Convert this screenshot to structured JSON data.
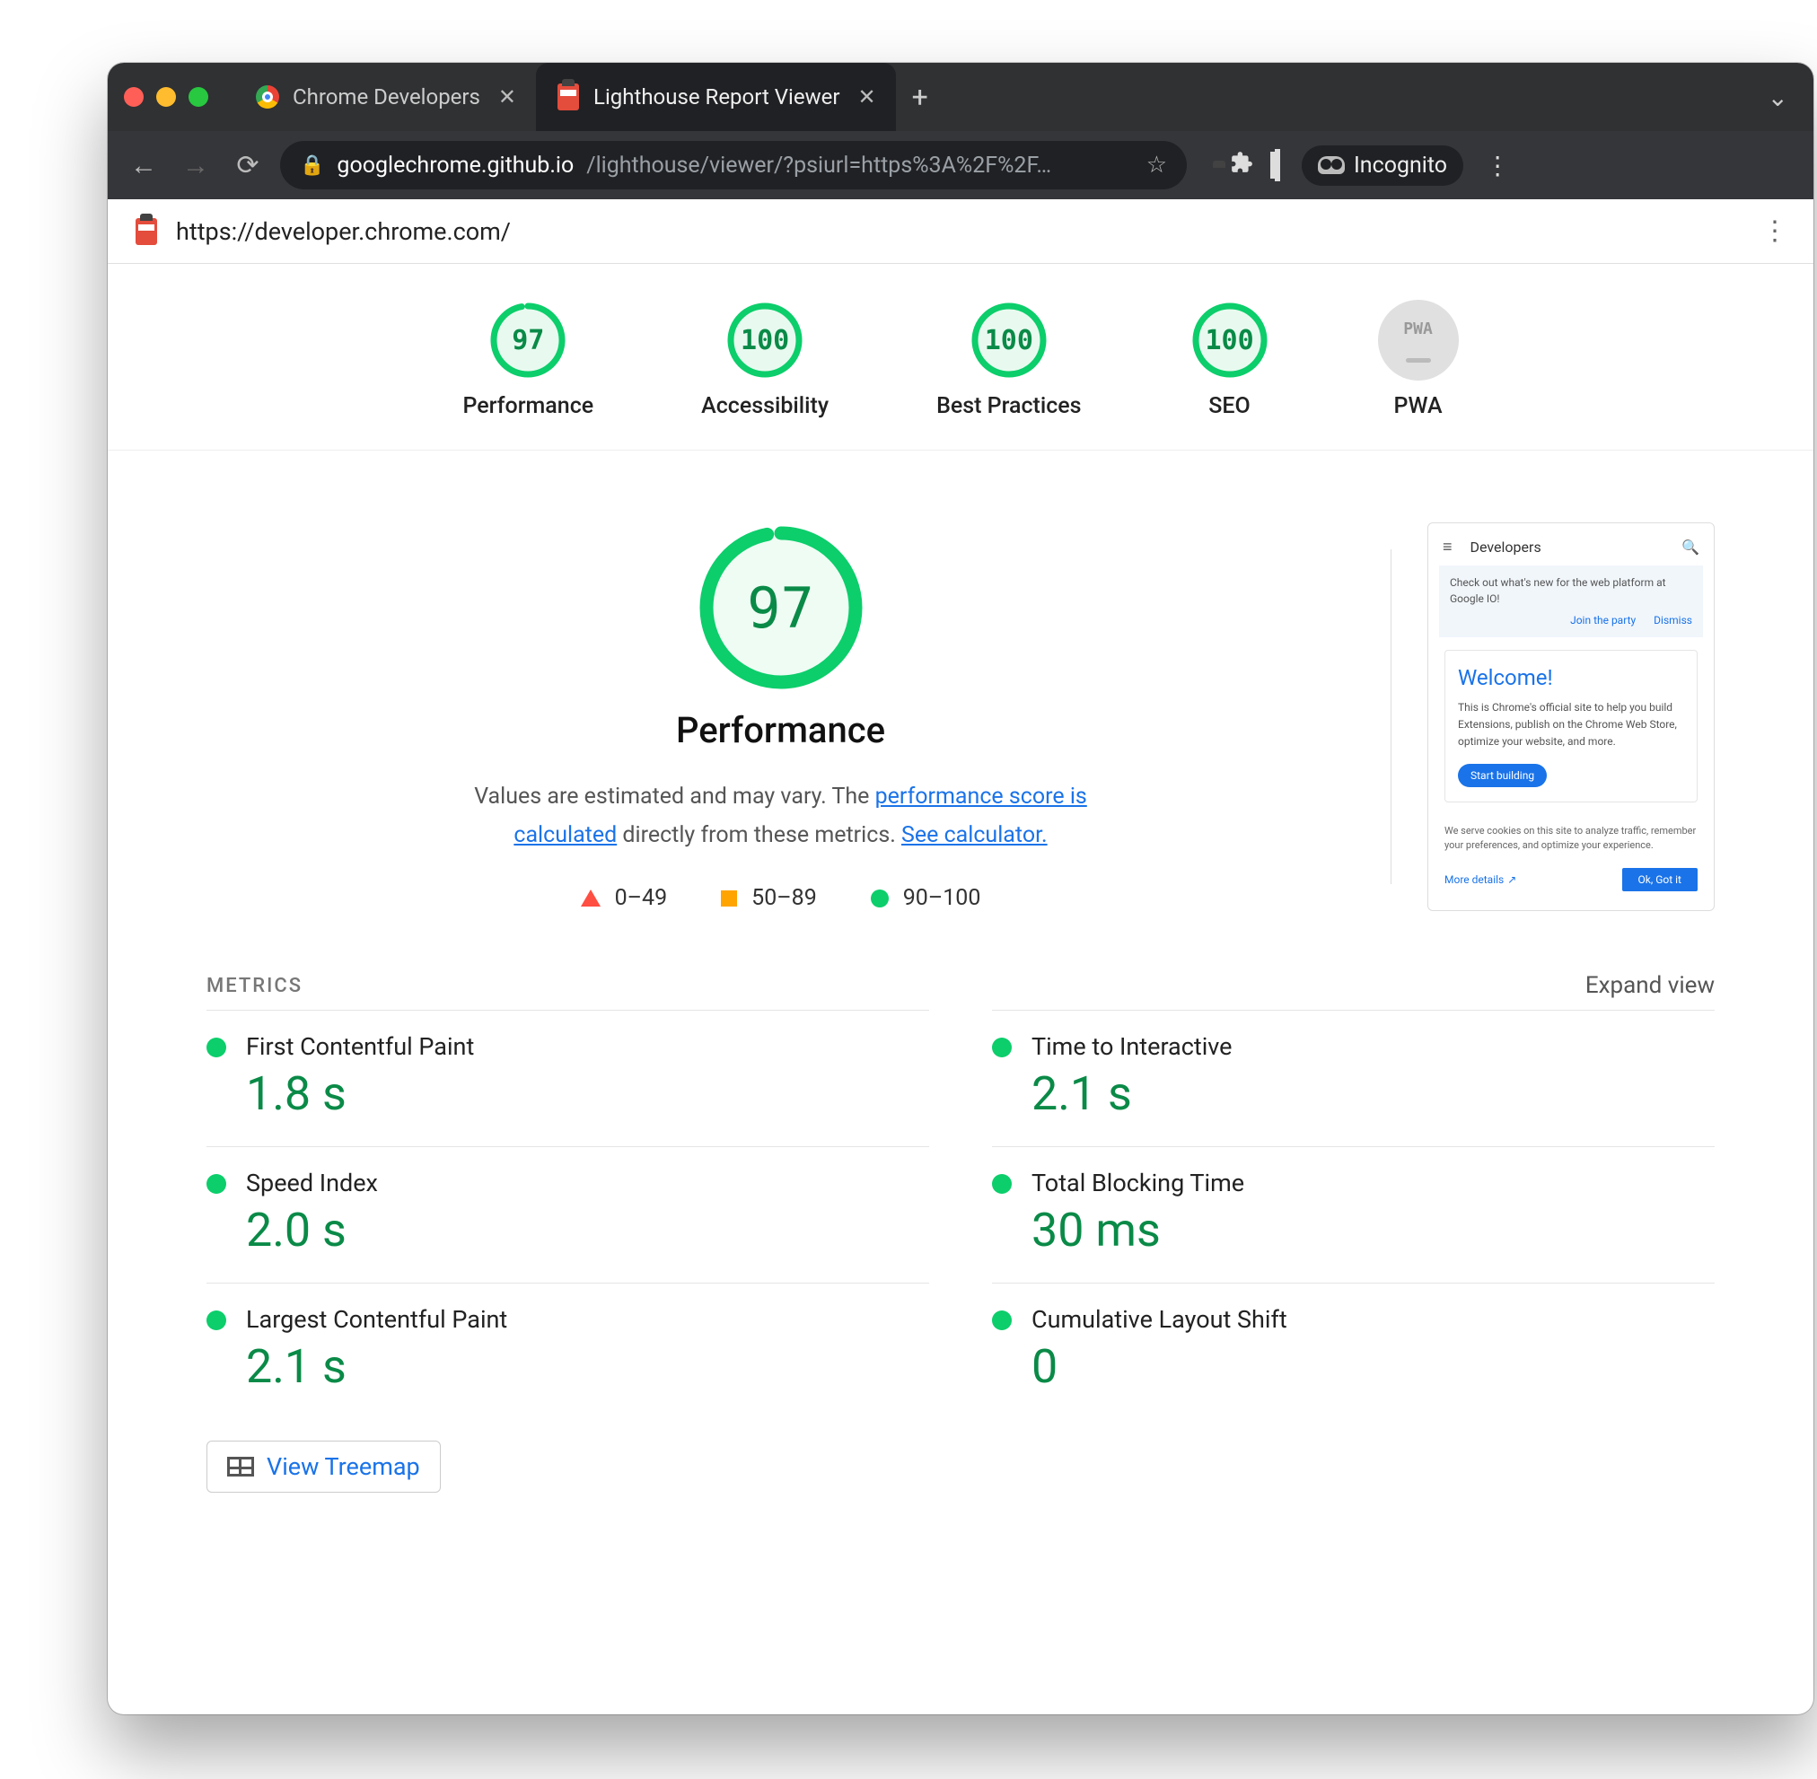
{
  "titlebar": {
    "tabs": [
      {
        "label": "Chrome Developers",
        "active": false
      },
      {
        "label": "Lighthouse Report Viewer",
        "active": true
      }
    ]
  },
  "addrbar": {
    "host": "googlechrome.github.io",
    "path": "/lighthouse/viewer/?psiurl=https%3A%2F%2F…",
    "incognito": "Incognito"
  },
  "toolbar": {
    "url": "https://developer.chrome.com/"
  },
  "gauges": [
    {
      "score": "97",
      "label": "Performance",
      "fraction": 0.97
    },
    {
      "score": "100",
      "label": "Accessibility",
      "fraction": 1.0
    },
    {
      "score": "100",
      "label": "Best Practices",
      "fraction": 1.0
    },
    {
      "score": "100",
      "label": "SEO",
      "fraction": 1.0
    }
  ],
  "pwa_label": "PWA",
  "pwa_badge": "PWA",
  "main": {
    "score": "97",
    "fraction": 0.97,
    "title": "Performance",
    "desc_prefix": "Values are estimated and may vary. The ",
    "desc_link1": "performance score is calculated",
    "desc_mid": " directly from these metrics. ",
    "desc_link2": "See calculator."
  },
  "legend": {
    "bad": "0–49",
    "mid": "50–89",
    "good": "90–100"
  },
  "screenshot": {
    "brand": "Developers",
    "banner": "Check out what's new for the web platform at Google IO!",
    "banner_link1": "Join the party",
    "banner_link2": "Dismiss",
    "welcome": "Welcome!",
    "body": "This is Chrome's official site to help you build Extensions, publish on the Chrome Web Store, optimize your website, and more.",
    "cta": "Start building",
    "cookie": "We serve cookies on this site to analyze traffic, remember your preferences, and optimize your experience.",
    "more": "More details",
    "ok": "Ok, Got it"
  },
  "metrics_header": {
    "title": "METRICS",
    "expand": "Expand view"
  },
  "metrics": [
    {
      "name": "First Contentful Paint",
      "value": "1.8 s"
    },
    {
      "name": "Time to Interactive",
      "value": "2.1 s"
    },
    {
      "name": "Speed Index",
      "value": "2.0 s"
    },
    {
      "name": "Total Blocking Time",
      "value": "30 ms"
    },
    {
      "name": "Largest Contentful Paint",
      "value": "2.1 s"
    },
    {
      "name": "Cumulative Layout Shift",
      "value": "0"
    }
  ],
  "treemap": {
    "label": "View Treemap"
  },
  "chart_data": {
    "type": "table",
    "title": "Lighthouse Report — https://developer.chrome.com/",
    "category_scores": [
      {
        "category": "Performance",
        "score": 97
      },
      {
        "category": "Accessibility",
        "score": 100
      },
      {
        "category": "Best Practices",
        "score": 100
      },
      {
        "category": "SEO",
        "score": 100
      },
      {
        "category": "PWA",
        "score": null
      }
    ],
    "performance_metrics": [
      {
        "metric": "First Contentful Paint",
        "value": 1.8,
        "unit": "s",
        "rating": "good"
      },
      {
        "metric": "Time to Interactive",
        "value": 2.1,
        "unit": "s",
        "rating": "good"
      },
      {
        "metric": "Speed Index",
        "value": 2.0,
        "unit": "s",
        "rating": "good"
      },
      {
        "metric": "Total Blocking Time",
        "value": 30,
        "unit": "ms",
        "rating": "good"
      },
      {
        "metric": "Largest Contentful Paint",
        "value": 2.1,
        "unit": "s",
        "rating": "good"
      },
      {
        "metric": "Cumulative Layout Shift",
        "value": 0,
        "unit": "",
        "rating": "good"
      }
    ],
    "score_legend": {
      "bad": "0–49",
      "average": "50–89",
      "good": "90–100"
    }
  }
}
